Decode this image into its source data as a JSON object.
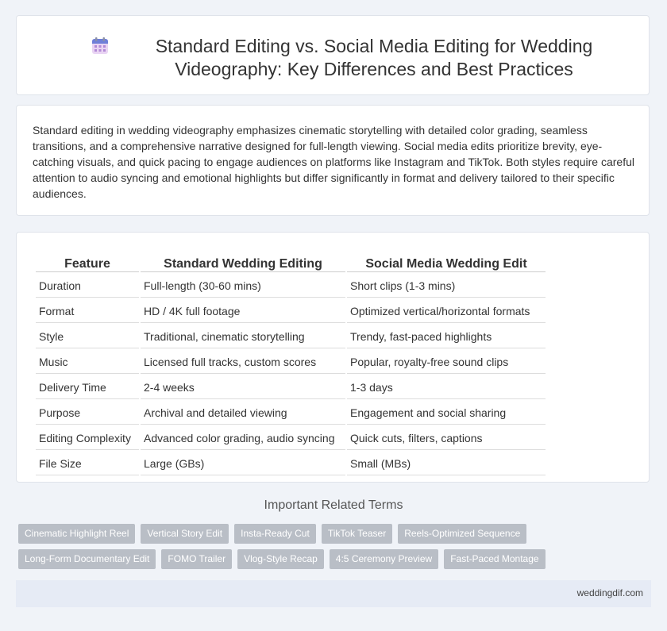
{
  "header": {
    "title": "Standard Editing vs. Social Media Editing for Wedding Videography: Key Differences and Best Practices",
    "icon": "calendar-icon"
  },
  "intro": {
    "text": "Standard editing in wedding videography emphasizes cinematic storytelling with detailed color grading, seamless transitions, and a comprehensive narrative designed for full-length viewing. Social media edits prioritize brevity, eye-catching visuals, and quick pacing to engage audiences on platforms like Instagram and TikTok. Both styles require careful attention to audio syncing and emotional highlights but differ significantly in format and delivery tailored to their specific audiences."
  },
  "table": {
    "headers": [
      "Feature",
      "Standard Wedding Editing",
      "Social Media Wedding Edit"
    ],
    "rows": [
      [
        "Duration",
        "Full-length (30-60 mins)",
        "Short clips (1-3 mins)"
      ],
      [
        "Format",
        "HD / 4K full footage",
        "Optimized vertical/horizontal formats"
      ],
      [
        "Style",
        "Traditional, cinematic storytelling",
        "Trendy, fast-paced highlights"
      ],
      [
        "Music",
        "Licensed full tracks, custom scores",
        "Popular, royalty-free sound clips"
      ],
      [
        "Delivery Time",
        "2-4 weeks",
        "1-3 days"
      ],
      [
        "Purpose",
        "Archival and detailed viewing",
        "Engagement and social sharing"
      ],
      [
        "Editing Complexity",
        "Advanced color grading, audio syncing",
        "Quick cuts, filters, captions"
      ],
      [
        "File Size",
        "Large (GBs)",
        "Small (MBs)"
      ]
    ]
  },
  "related": {
    "title": "Important Related Terms",
    "row1": [
      "Cinematic Highlight Reel",
      "Vertical Story Edit",
      "Insta-Ready Cut",
      "TikTok Teaser",
      "Reels-Optimized Sequence"
    ],
    "row2": [
      "Long-Form Documentary Edit",
      "FOMO Trailer",
      "Vlog-Style Recap",
      "4:5 Ceremony Preview",
      "Fast-Paced Montage"
    ]
  },
  "footer": {
    "site": "weddingdif.com"
  },
  "colors": {
    "background": "#f0f3f8",
    "tag": "#b9bec6",
    "footer": "#e6ebf5"
  }
}
